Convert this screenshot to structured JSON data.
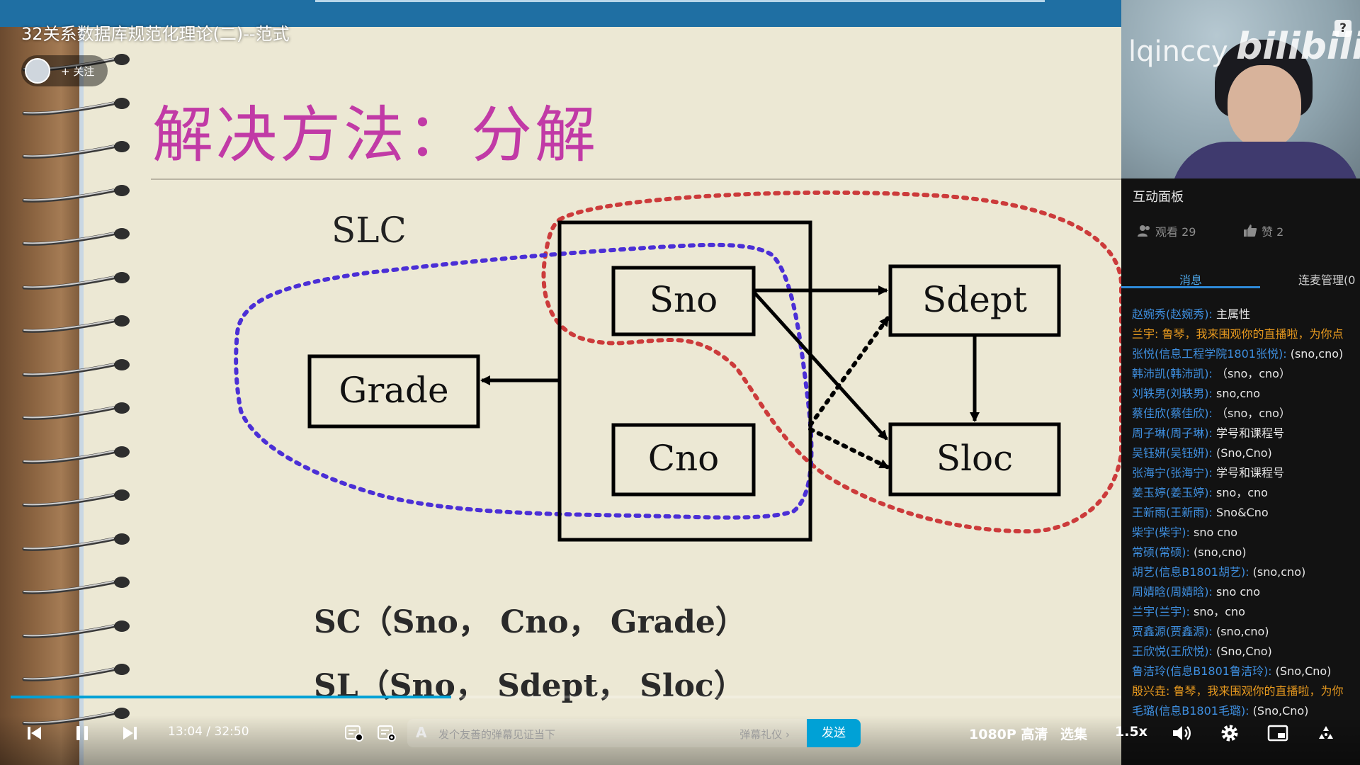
{
  "video": {
    "title": "32关系数据库规范化理论(二)--范式",
    "follow_label": "+ 关注"
  },
  "slide": {
    "title": "解决方法：分解",
    "diagram": {
      "relation_label": "SLC",
      "boxes": {
        "sno": "Sno",
        "cno": "Cno",
        "grade": "Grade",
        "sdept": "Sdept",
        "sloc": "Sloc"
      }
    },
    "equations": [
      "SC（Sno， Cno， Grade）",
      "SL（Sno， Sdept， Sloc）"
    ]
  },
  "webcam": {
    "channel_name": "lqinccy",
    "logo_text": "bilibili",
    "help_label": "?"
  },
  "panel": {
    "title": "互动面板",
    "viewers": "观看 29",
    "likes": "赞 2",
    "tabs": [
      "消息",
      "连麦管理(0"
    ],
    "messages": [
      {
        "user": "赵婉秀(赵婉秀):",
        "text": " 主属性",
        "style": "normal"
      },
      {
        "user": "兰宇:",
        "text": " 鲁琴，我来围观你的直播啦，为你点",
        "style": "orange"
      },
      {
        "user": "张悦(信息工程学院1801张悦):",
        "text": " (sno,cno)",
        "style": "normal"
      },
      {
        "user": "韩沛凯(韩沛凯):",
        "text": " （sno，cno）",
        "style": "normal"
      },
      {
        "user": "刘轶男(刘轶男):",
        "text": " sno,cno",
        "style": "normal"
      },
      {
        "user": "蔡佳欣(蔡佳欣):",
        "text": " （sno，cno）",
        "style": "normal"
      },
      {
        "user": "周子琳(周子琳):",
        "text": " 学号和课程号",
        "style": "normal"
      },
      {
        "user": "吴钰妍(吴钰妍):",
        "text": " (Sno,Cno)",
        "style": "normal"
      },
      {
        "user": "张海宁(张海宁):",
        "text": " 学号和课程号",
        "style": "normal"
      },
      {
        "user": "姜玉婷(姜玉婷):",
        "text": " sno，cno",
        "style": "normal"
      },
      {
        "user": "王新雨(王新雨):",
        "text": " Sno&Cno",
        "style": "normal"
      },
      {
        "user": "柴宇(柴宇):",
        "text": " sno cno",
        "style": "normal"
      },
      {
        "user": "常硕(常硕):",
        "text": " (sno,cno)",
        "style": "normal"
      },
      {
        "user": "胡艺(信息B1801胡艺):",
        "text": " (sno,cno)",
        "style": "normal"
      },
      {
        "user": "周婧晗(周婧晗):",
        "text": " sno cno",
        "style": "normal"
      },
      {
        "user": "兰宇(兰宇):",
        "text": " sno，cno",
        "style": "normal"
      },
      {
        "user": "贾鑫源(贾鑫源):",
        "text": " (sno,cno)",
        "style": "normal"
      },
      {
        "user": "王欣悦(王欣悦):",
        "text": " (Sno,Cno)",
        "style": "normal"
      },
      {
        "user": "鲁洁玲(信息B1801鲁洁玲):",
        "text": " (Sno,Cno)",
        "style": "normal"
      },
      {
        "user": "殷兴垚:",
        "text": " 鲁琴，我来围观你的直播啦，为你",
        "style": "orange"
      },
      {
        "user": "毛璐(信息B1801毛璐):",
        "text": " (Sno,Cno)",
        "style": "normal"
      }
    ]
  },
  "player": {
    "current_time": "13:04",
    "duration": "32:50",
    "time_separator": " / ",
    "progress_fraction": 0.397,
    "danmaku_prefix": "A",
    "danmaku_placeholder": "发个友善的弹幕见证当下",
    "danmaku_etiquette": "弹幕礼仪 ›",
    "send_label": "发送",
    "quality": "1080P 高清",
    "episodes": "选集",
    "speed": "1.5x"
  },
  "colors": {
    "accent": "#00a1d6",
    "title_magenta": "#c13aa6",
    "slide_topbar": "#1f6fa3",
    "chat_user": "#3e8fe0",
    "chat_gift": "#e89a1f",
    "dotted_red": "#cc3b3b",
    "dotted_blue": "#4b2fd6"
  }
}
